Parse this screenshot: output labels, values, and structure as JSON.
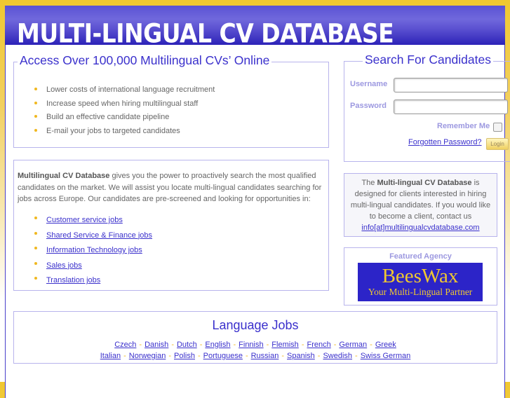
{
  "header": {
    "title": "MULTI-LINGUAL CV DATABASE"
  },
  "access_box": {
    "legend": "Access Over 100,000 Multilingual CVs’ Online",
    "bullets": [
      "Lower costs of international language recruitment",
      "Increase speed when hiring multilingual staff",
      "Build an effective candidate pipeline",
      "E-mail your jobs to targeted candidates"
    ]
  },
  "intro_box": {
    "brand": "Multilingual CV Database",
    "text": " gives you the power to proactively search the most qualified candidates on the market. We will assist you locate multi-lingual candidates searching for jobs across Europe. Our candidates are pre-screened and looking for opportunities in:",
    "links": [
      "Customer service jobs",
      "Shared Service & Finance jobs",
      "Information Technology jobs",
      "Sales jobs",
      "Translation jobs"
    ]
  },
  "search_box": {
    "legend": "Search For Candidates",
    "username_label": "Username",
    "username_value": "",
    "password_label": "Password",
    "password_value": "",
    "remember_label": "Remember Me",
    "remember_checked": false,
    "forgot_link": "Forgotten Password?",
    "login_button": "Login"
  },
  "info_box": {
    "prefix": "The ",
    "brand": "Multi-lingual CV Database",
    "text": " is designed for clients interested in hiring multi-lingual candidates. If you would like to become a client, contact us",
    "email": "info[at]multilingualcvdatabase.com"
  },
  "featured": {
    "title": "Featured Agency",
    "logo_name": "BeesWax",
    "logo_tagline": "Your Multi-Lingual Partner"
  },
  "language_jobs": {
    "title": "Language Jobs",
    "separator": "-",
    "row1": [
      "Czech",
      "Danish",
      "Dutch",
      "English",
      "Finnish",
      "Flemish",
      "French",
      "German",
      "Greek"
    ],
    "row2": [
      "Italian",
      "Norwegian",
      "Polish",
      "Portuguese",
      "Russian",
      "Spanish",
      "Swedish",
      "Swiss German"
    ]
  },
  "colors": {
    "brand_blue": "#3a30cc",
    "accent_yellow": "#f0c830",
    "border_lavender": "#b8b4ec"
  }
}
